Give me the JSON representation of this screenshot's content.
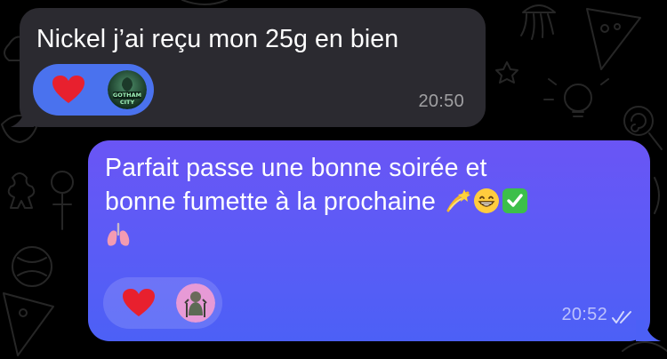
{
  "chat": {
    "messages": [
      {
        "direction": "incoming",
        "text": "Nickel j’ai reçu mon 25g en bien",
        "time": "20:50",
        "reaction": {
          "emoji": "heart-icon",
          "avatar_label": "GOTHAM CITY"
        }
      },
      {
        "direction": "outgoing",
        "text_line1": "Parfait passe une bonne soirée et",
        "text_line2": "bonne fumette à la prochaine",
        "emojis": [
          "dizzy-star-emoji",
          "grinning-emoji",
          "check-mark-emoji",
          "lungs-emoji"
        ],
        "time": "20:52",
        "status": "read-double-check",
        "reaction": {
          "emoji": "heart-icon",
          "avatar": "reactor-avatar"
        }
      }
    ]
  },
  "colors": {
    "background": "#000000",
    "incoming_bubble": "#2b2a30",
    "outgoing_bubble_top": "#6a55f5",
    "outgoing_bubble_bottom": "#4c60f6",
    "reaction_pill_incoming": "#4a72ee",
    "heart": "#e8202e",
    "time_text": "#9a9aa2"
  }
}
